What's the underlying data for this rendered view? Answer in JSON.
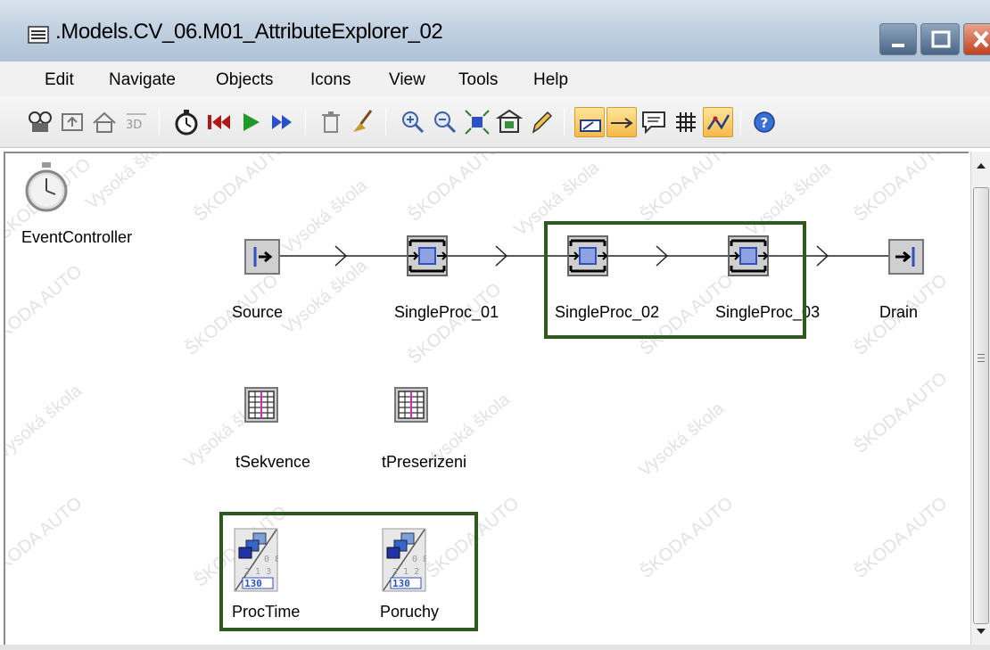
{
  "window": {
    "title": ".Models.CV_06.M01_AttributeExplorer_02"
  },
  "menu": [
    "Edit",
    "Navigate",
    "Objects",
    "Icons",
    "View",
    "Tools",
    "Help"
  ],
  "toolbar": {
    "buttons": [
      "explorer-icon",
      "up-folder-icon",
      "home-icon",
      "3d-icon",
      "event-controller-icon",
      "reset-icon",
      "start-icon",
      "fast-forward-icon",
      "delete-icon",
      "clean-icon",
      "zoom-in-icon",
      "zoom-out-icon",
      "fit-icon",
      "frame-icon",
      "pencil-icon",
      "connector-mode-icon",
      "connector-icon",
      "comment-icon",
      "grid-icon",
      "signal-icon",
      "help-icon"
    ],
    "active_color": "#f6b94a"
  },
  "objects": {
    "event_controller": "EventController",
    "source": "Source",
    "single_proc_01": "SingleProc_01",
    "single_proc_02": "SingleProc_02",
    "single_proc_03": "SingleProc_03",
    "drain": "Drain",
    "table_1": "tSekvence",
    "table_2": "tPreserizeni",
    "dist_1": "ProcTime",
    "dist_2": "Poruchy"
  },
  "watermark": {
    "text_a": "ŠKODA AUTO",
    "text_b": "Vysoká škola"
  },
  "colors": {
    "highlight": "#2f5a1f",
    "proc_fill": "#8fa2e0"
  }
}
